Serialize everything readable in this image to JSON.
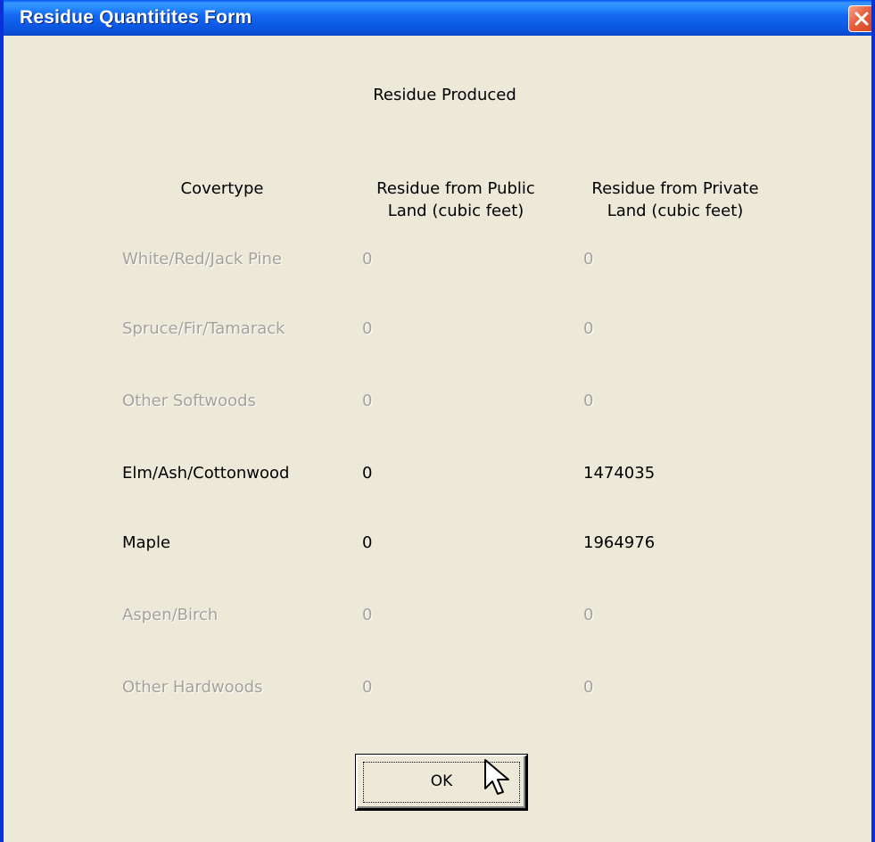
{
  "window": {
    "title": "Residue Quantitites Form"
  },
  "heading": "Residue Produced",
  "columns": {
    "covertype": "Covertype",
    "public_line1": "Residue from Public",
    "public_line2": "Land (cubic feet)",
    "private_line1": "Residue from Private",
    "private_line2": "Land (cubic feet)"
  },
  "rows": [
    {
      "covertype": "White/Red/Jack Pine",
      "public": "0",
      "private": "0",
      "enabled": false
    },
    {
      "covertype": "Spruce/Fir/Tamarack",
      "public": "0",
      "private": "0",
      "enabled": false
    },
    {
      "covertype": "Other Softwoods",
      "public": "0",
      "private": "0",
      "enabled": false
    },
    {
      "covertype": "Elm/Ash/Cottonwood",
      "public": "0",
      "private": "1474035",
      "enabled": true
    },
    {
      "covertype": "Maple",
      "public": "0",
      "private": "1964976",
      "enabled": true
    },
    {
      "covertype": "Aspen/Birch",
      "public": "0",
      "private": "0",
      "enabled": false
    },
    {
      "covertype": "Other Hardwoods",
      "public": "0",
      "private": "0",
      "enabled": false
    }
  ],
  "ok_button": {
    "label": "OK"
  },
  "icons": {
    "close": "close-icon",
    "cursor": "mouse-cursor-icon"
  },
  "colors": {
    "titlebar": "#0a5ae6",
    "background": "#ece9d8",
    "disabled_text": "#a4a29a",
    "close_button": "#e5603f"
  }
}
